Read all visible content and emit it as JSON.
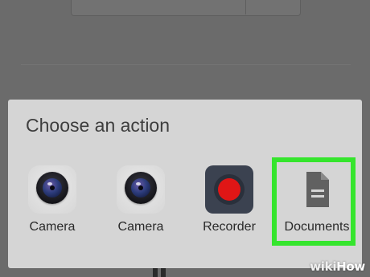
{
  "dialog": {
    "title": "Choose an action",
    "apps": [
      {
        "label": "Camera",
        "icon": "camera-icon"
      },
      {
        "label": "Camera",
        "icon": "camera-icon"
      },
      {
        "label": "Recorder",
        "icon": "recorder-icon"
      },
      {
        "label": "Documents",
        "icon": "document-icon"
      }
    ]
  },
  "highlight": {
    "target": "Documents",
    "color": "#35e52d"
  },
  "watermark": {
    "wiki": "wiki",
    "how": "How"
  }
}
